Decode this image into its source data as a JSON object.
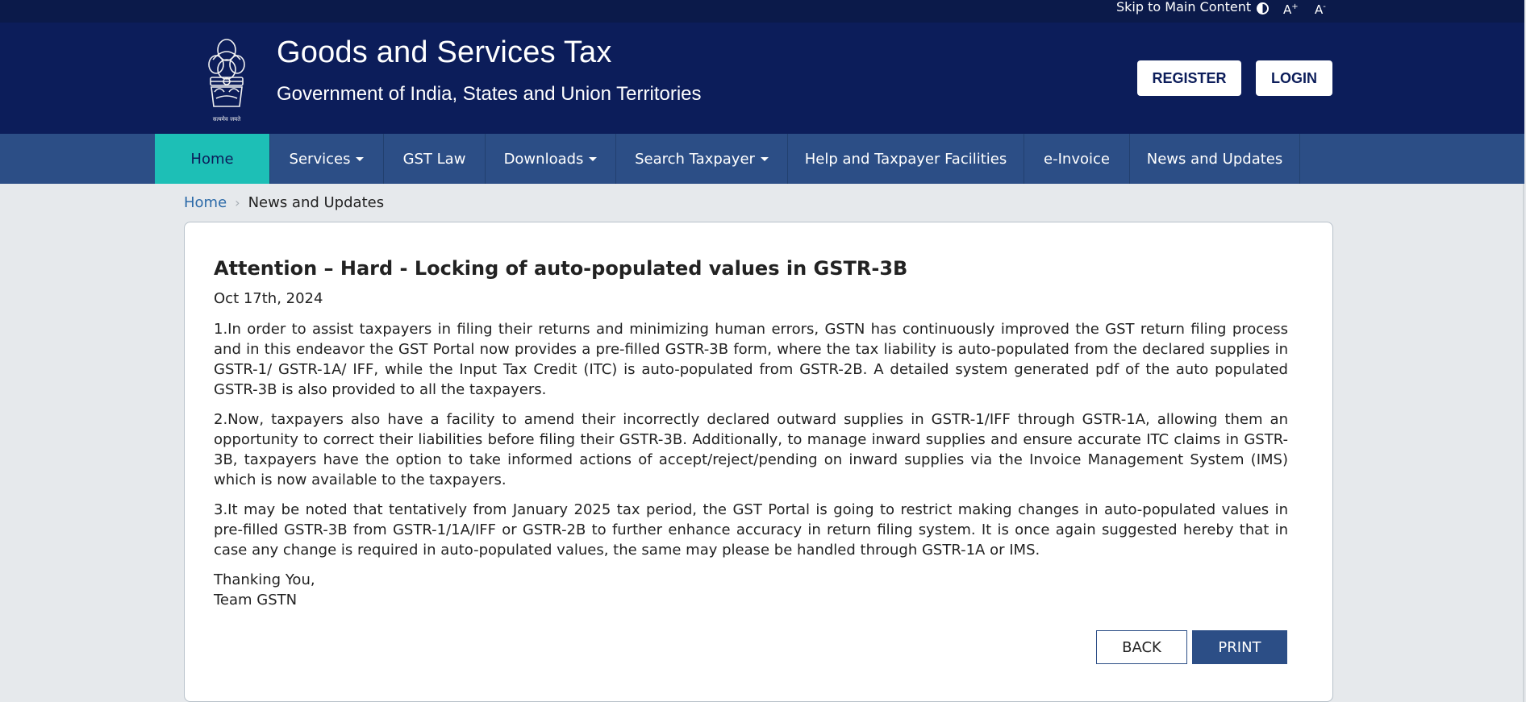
{
  "topbar": {
    "skip_label": "Skip to Main Content",
    "font_increase": "A",
    "font_increase_sup": "+",
    "font_decrease": "A",
    "font_decrease_sup": "-"
  },
  "header": {
    "title": "Goods and Services Tax",
    "subtitle": "Government of India, States and Union Territories",
    "emblem_caption": "सत्यमेव जयते",
    "register_label": "REGISTER",
    "login_label": "LOGIN"
  },
  "nav": {
    "items": [
      {
        "label": "Home",
        "dropdown": false,
        "active": true
      },
      {
        "label": "Services",
        "dropdown": true,
        "active": false
      },
      {
        "label": "GST Law",
        "dropdown": false,
        "active": false
      },
      {
        "label": "Downloads",
        "dropdown": true,
        "active": false
      },
      {
        "label": "Search Taxpayer",
        "dropdown": true,
        "active": false
      },
      {
        "label": "Help and Taxpayer Facilities",
        "dropdown": false,
        "active": false
      },
      {
        "label": "e-Invoice",
        "dropdown": false,
        "active": false
      },
      {
        "label": "News and Updates",
        "dropdown": false,
        "active": false
      }
    ]
  },
  "breadcrumb": {
    "home": "Home",
    "separator": "›",
    "current": "News and Updates"
  },
  "article": {
    "title": "Attention – Hard - Locking of auto-populated values in GSTR-3B",
    "date": "Oct 17th, 2024",
    "paragraphs": [
      "1.In order to assist taxpayers in filing their returns and minimizing human errors, GSTN has continuously improved the GST return filing process and in this endeavor the GST Portal now provides a pre-filled GSTR-3B form, where the tax liability is auto-populated from the declared supplies in GSTR-1/ GSTR-1A/ IFF, while the Input Tax Credit (ITC) is auto-populated from GSTR-2B. A detailed system generated pdf of the auto populated GSTR-3B is also provided to all the taxpayers.",
      "2.Now, taxpayers also have a facility to amend their incorrectly declared outward supplies in GSTR-1/IFF through GSTR-1A, allowing them an opportunity to correct their liabilities before filing their GSTR-3B. Additionally, to manage inward supplies and ensure accurate ITC claims in GSTR-3B, taxpayers have the option to take informed actions of accept/reject/pending on inward supplies via the Invoice Management System (IMS) which is now available to the taxpayers.",
      "3.It may be noted that tentatively from January 2025 tax period, the GST Portal is going to restrict making changes in auto-populated values in pre-filled GSTR-3B from GSTR-1/1A/IFF or GSTR-2B to further enhance accuracy in return filing system. It is once again suggested hereby that in case any change is required in auto-populated values, the same may please be handled through GSTR-1A or IMS."
    ],
    "signoff_line1": "Thanking You,",
    "signoff_line2": "Team GSTN",
    "back_label": "BACK",
    "print_label": "PRINT"
  },
  "colors": {
    "topbar": "#0b1a4a",
    "header": "#0c1d5a",
    "nav": "#2c4e86",
    "nav_active": "#1dbfb6",
    "link": "#2c6aa8"
  }
}
